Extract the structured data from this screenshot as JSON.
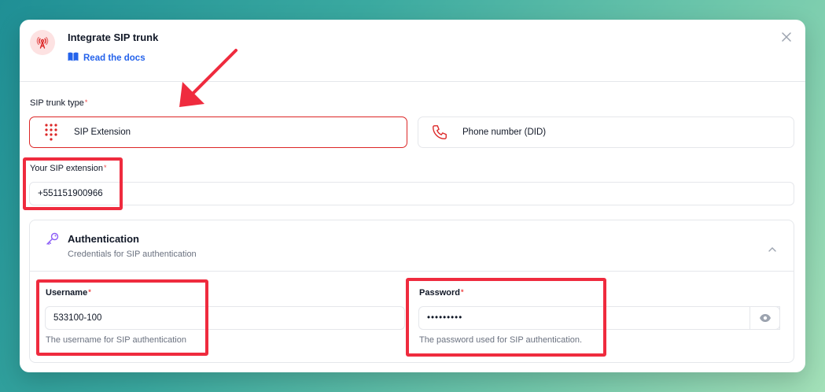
{
  "modal": {
    "title": "Integrate SIP trunk",
    "docs_label": "Read the docs"
  },
  "trunk_type": {
    "label": "SIP trunk type",
    "options": [
      {
        "label": "SIP Extension",
        "selected": true,
        "icon": "dialpad-icon"
      },
      {
        "label": "Phone number (DID)",
        "selected": false,
        "icon": "phone-icon"
      }
    ]
  },
  "extension": {
    "label": "Your SIP extension",
    "value": "+551151900966"
  },
  "auth": {
    "title": "Authentication",
    "subtitle": "Credentials for SIP authentication",
    "username": {
      "label": "Username",
      "value": "533100-100",
      "help": "The username for SIP authentication"
    },
    "password": {
      "label": "Password",
      "value": "•••••••••",
      "help": "The password used for SIP authentication."
    }
  },
  "colors": {
    "accent_red": "#dc2626",
    "link_blue": "#2563eb",
    "annotation_red": "#ef2b3e",
    "key_purple": "#8b5cf6"
  }
}
